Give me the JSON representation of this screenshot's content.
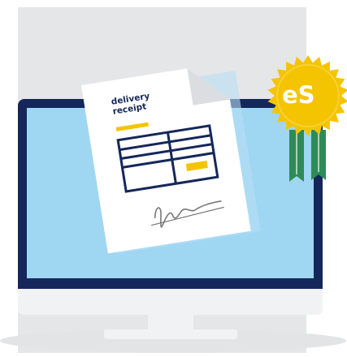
{
  "illustration": {
    "document": {
      "title_line1": "delivery",
      "title_line2": "receipt"
    },
    "badge": {
      "label": "eS"
    }
  },
  "colors": {
    "backdrop": "#e5e6e8",
    "monitor_frame": "#15275a",
    "screen": "#9fd6f2",
    "monitor_stand": "#f1f2f4",
    "paper": "#ffffff",
    "paper_fold": "#dcdde0",
    "ink": "#15275a",
    "accent_yellow": "#f5c400",
    "seal_gold": "#f5c400",
    "ribbon_green": "#2e8b57",
    "signature_gray": "#777777"
  }
}
